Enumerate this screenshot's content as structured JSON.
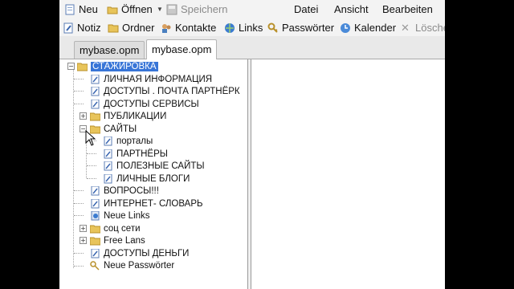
{
  "toolbar": {
    "new_label": "Neu",
    "open_label": "Öffnen",
    "save_label": "Speichern",
    "menu": [
      "Datei",
      "Ansicht",
      "Bearbeiten"
    ],
    "notiz": "Notiz",
    "ordner": "Ordner",
    "kontakte": "Kontakte",
    "links": "Links",
    "passwoerter": "Passwörter",
    "kalender": "Kalender",
    "loeschen": "Lösche"
  },
  "tabs": [
    "mybase.opm",
    "mybase.opm"
  ],
  "tree": {
    "root": "СТАЖИРОВКА",
    "items": [
      "ЛИЧНАЯ ИНФОРМАЦИЯ",
      "ДОСТУПЫ . ПОЧТА ПАРТНЁРК",
      "ДОСТУПЫ СЕРВИСЫ",
      "ПУБЛИКАЦИИ",
      "САЙТЫ",
      "порталы",
      "ПАРТНЁРЫ",
      "ПОЛЕЗНЫЕ САЙТЫ",
      "ЛИЧНЫЕ БЛОГИ",
      "ВОПРОСЫ!!!",
      "ИНТЕРНЕТ- СЛОВАРЬ",
      "Neue Links",
      "соц сети",
      "Free Lans",
      "ДОСТУПЫ ДЕНЬГИ",
      "Neue Passwörter"
    ]
  },
  "colors": {
    "selection": "#3875d7",
    "folder": "#e8c45a"
  },
  "icons": [
    "new-note-icon",
    "open-folder-icon",
    "save-icon",
    "notiz-icon",
    "folder-icon",
    "contacts-icon",
    "links-icon",
    "key-icon",
    "calendar-icon",
    "delete-icon",
    "note-icon",
    "mouse-cursor-icon"
  ]
}
